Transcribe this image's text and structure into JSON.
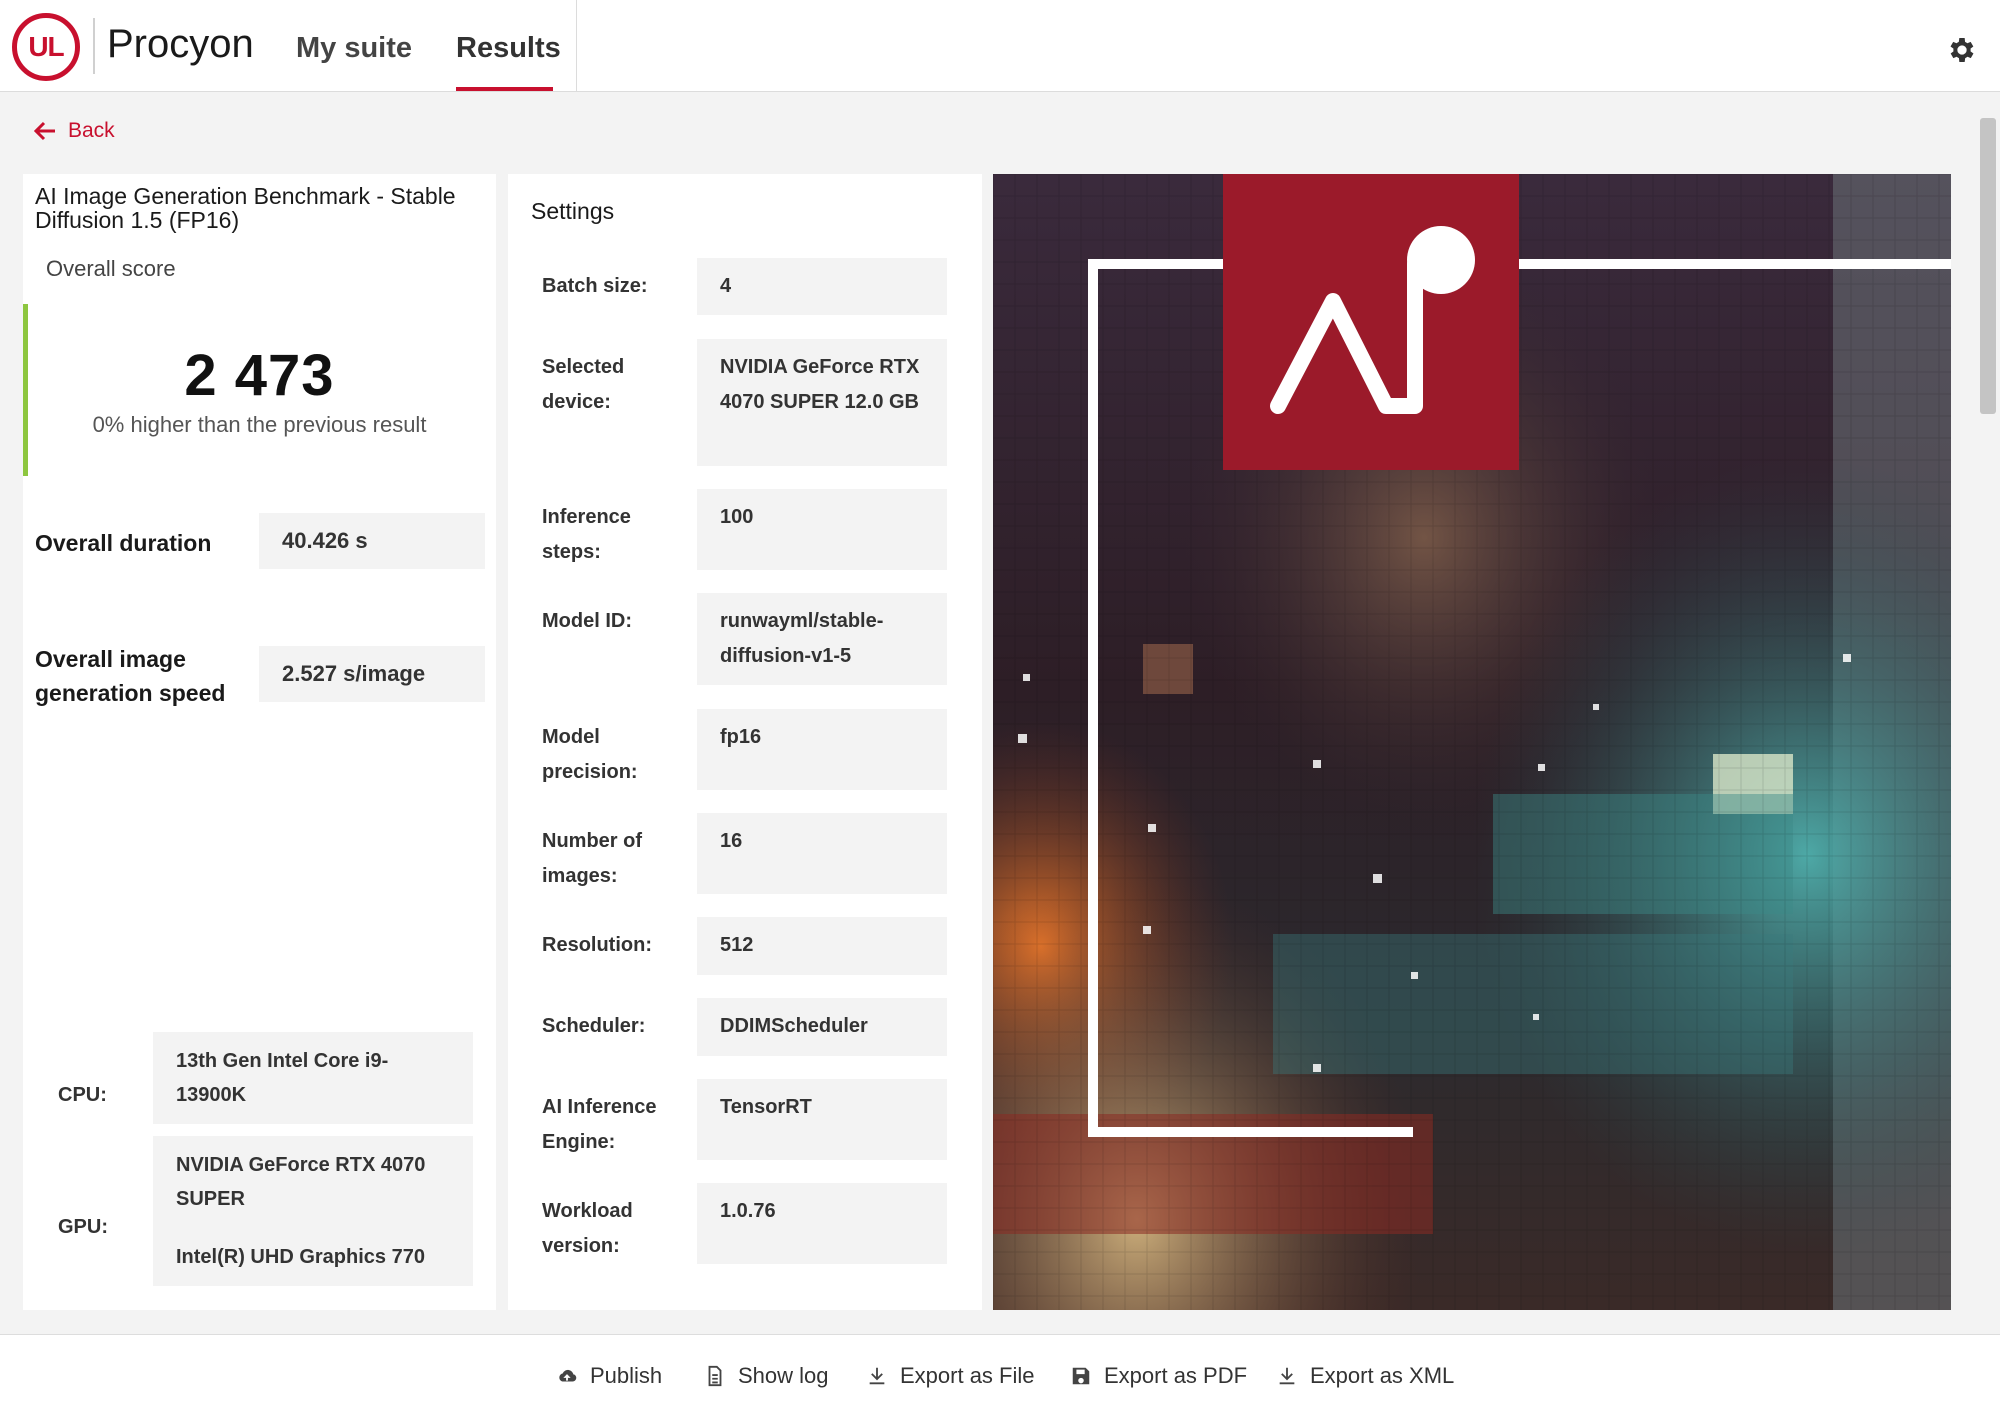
{
  "header": {
    "logo_text": "UL",
    "brand": "Procyon",
    "nav": [
      {
        "label": "My suite"
      },
      {
        "label": "Results"
      }
    ]
  },
  "back_label": "Back",
  "summary": {
    "benchmark_title": "AI Image Generation Benchmark - Stable Diffusion 1.5 (FP16)",
    "overall_score_label": "Overall score",
    "overall_score": "2 473",
    "score_comparison": "0% higher than the previous result",
    "overall_duration_label": "Overall duration",
    "overall_duration": "40.426 s",
    "image_speed_label": "Overall image generation speed",
    "image_speed": "2.527 s/image",
    "cpu_label": "CPU:",
    "cpu": "13th Gen Intel Core i9-13900K",
    "gpu_label": "GPU:",
    "gpu_primary": "NVIDIA GeForce RTX 4070 SUPER",
    "gpu_secondary": "Intel(R) UHD Graphics 770"
  },
  "settings": {
    "title": "Settings",
    "items": [
      {
        "label": "Batch size:",
        "value": "4"
      },
      {
        "label": "Selected device:",
        "value": "NVIDIA GeForce RTX 4070 SUPER 12.0 GB"
      },
      {
        "label": "Inference steps:",
        "value": "100"
      },
      {
        "label": "Model ID:",
        "value": "runwayml/stable-diffusion-v1-5"
      },
      {
        "label": "Model precision:",
        "value": "fp16"
      },
      {
        "label": "Number of images:",
        "value": "16"
      },
      {
        "label": "Resolution:",
        "value": "512"
      },
      {
        "label": "Scheduler:",
        "value": "DDIMScheduler"
      },
      {
        "label": "AI Inference Engine:",
        "value": "TensorRT"
      },
      {
        "label": "Workload version:",
        "value": "1.0.76"
      }
    ]
  },
  "footer": {
    "publish": "Publish",
    "show_log": "Show log",
    "export_file": "Export as File",
    "export_pdf": "Export as PDF",
    "export_xml": "Export as XML"
  },
  "colors": {
    "accent": "#c8102e",
    "score_bar": "#8dc63f"
  },
  "icons": [
    "ul-logo",
    "gear-icon",
    "back-arrow-icon",
    "cloud-upload-icon",
    "document-icon",
    "download-icon",
    "save-icon",
    "ai-logo"
  ]
}
